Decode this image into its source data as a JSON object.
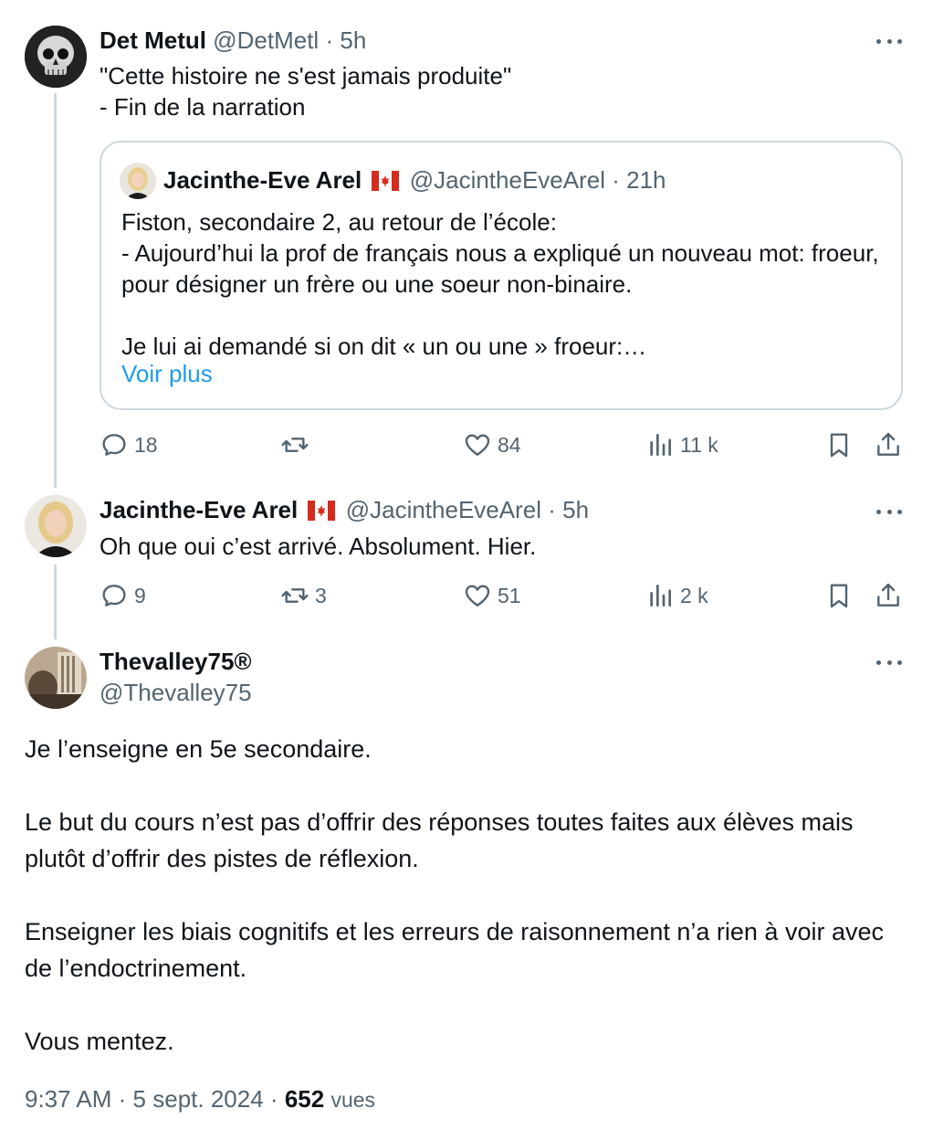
{
  "post1": {
    "name": "Det Metul",
    "handle": "@DetMetl",
    "time": "5h",
    "text": "\"Cette histoire ne s'est jamais produite\"\n- Fin de la narration",
    "quote": {
      "name": "Jacinthe-Eve Arel",
      "flag": "🇨🇦",
      "handle": "@JacintheEveArel",
      "time": "21h",
      "text": "Fiston, secondaire 2, au retour de l’école:\n - Aujourd’hui la prof de français nous a expliqué un nouveau mot: froeur, pour désigner un frère ou une soeur non-binaire.\n\nJe lui ai demandé si on dit « un ou une » froeur:…",
      "more_label": "Voir plus"
    },
    "actions": {
      "replies": "18",
      "reposts": "",
      "likes": "84",
      "views": "11 k"
    }
  },
  "post2": {
    "name": "Jacinthe-Eve Arel",
    "flag": "🇨🇦",
    "handle": "@JacintheEveArel",
    "time": "5h",
    "text": "Oh que oui c’est arrivé. Absolument. Hier.",
    "actions": {
      "replies": "9",
      "reposts": "3",
      "likes": "51",
      "views": "2 k"
    }
  },
  "post3": {
    "name": "Thevalley75®",
    "handle": "@Thevalley75",
    "text": "Je l’enseigne en 5e secondaire.\n\nLe but du cours n’est pas d’offrir des réponses toutes faites aux élèves mais plutôt d’offrir des pistes de réflexion.\n\nEnseigner les biais cognitifs et les erreurs de raisonnement n’a rien à voir avec de l’endoctrinement.\n\nVous mentez.",
    "time": "9:37 AM",
    "date": "5 sept. 2024",
    "views_count": "652",
    "views_label": "vues"
  },
  "separator": "·",
  "colors": {
    "text": "#0f1419",
    "muted": "#536471",
    "link": "#1d9bf0",
    "border": "#cfd9de"
  }
}
